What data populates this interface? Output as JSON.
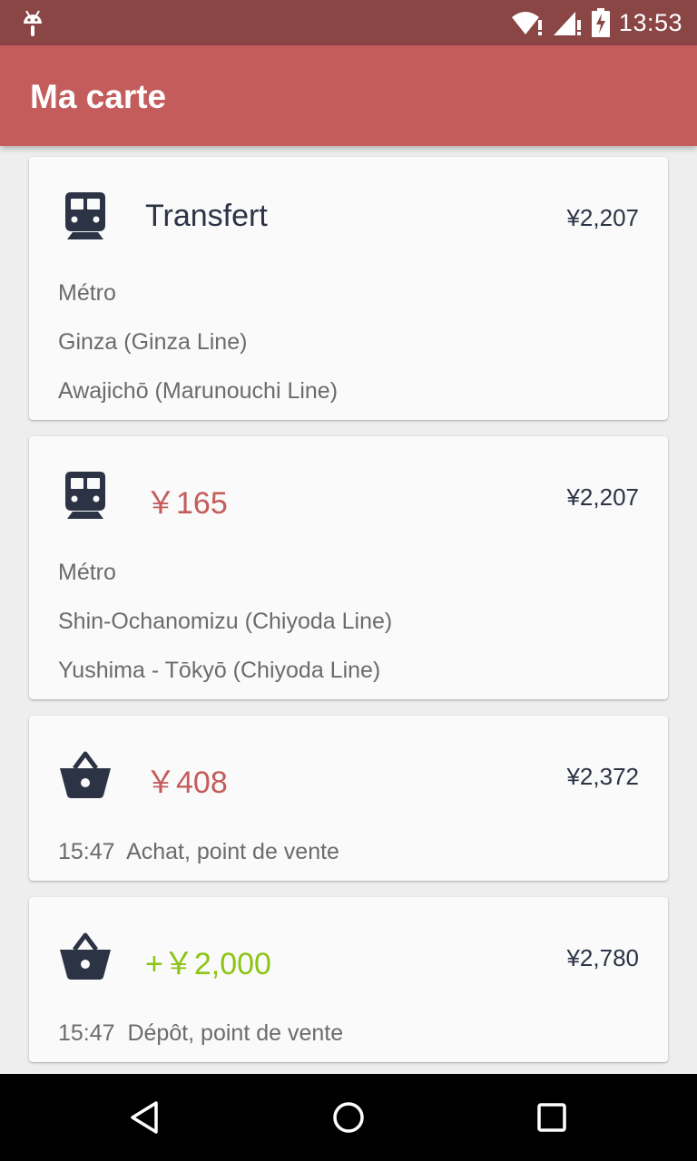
{
  "status_bar": {
    "time": "13:53",
    "icons": [
      "android-icon",
      "wifi-icon",
      "signal-icon",
      "battery-charging-icon"
    ]
  },
  "app_bar": {
    "title": "Ma carte"
  },
  "transactions": [
    {
      "icon": "train-icon",
      "amount": "Transfert",
      "amount_color": "#2c3345",
      "balance": "¥2,207",
      "details": [
        "Métro",
        "Ginza (Ginza Line)",
        "Awajichō (Marunouchi Line)"
      ]
    },
    {
      "icon": "train-icon",
      "amount": "￥165",
      "amount_color": "#c45c5c",
      "balance": "¥2,207",
      "details": [
        "Métro",
        "Shin-Ochanomizu (Chiyoda Line)",
        "Yushima - Tōkyō (Chiyoda Line)"
      ]
    },
    {
      "icon": "basket-icon",
      "amount": "￥408",
      "amount_color": "#c45c5c",
      "balance": "¥2,372",
      "details": [
        "15:47  Achat, point de vente"
      ]
    },
    {
      "icon": "basket-icon",
      "amount": "+￥2,000",
      "amount_color": "#8cc414",
      "balance": "¥2,780",
      "details": [
        "15:47  Dépôt, point de vente"
      ]
    }
  ],
  "nav_bar": {
    "buttons": [
      "back-icon",
      "home-icon",
      "recents-icon"
    ]
  },
  "colors": {
    "status_bar": "#8a4545",
    "app_bar": "#c45c5c",
    "icon": "#2c3345",
    "background": "#eeeeee"
  }
}
